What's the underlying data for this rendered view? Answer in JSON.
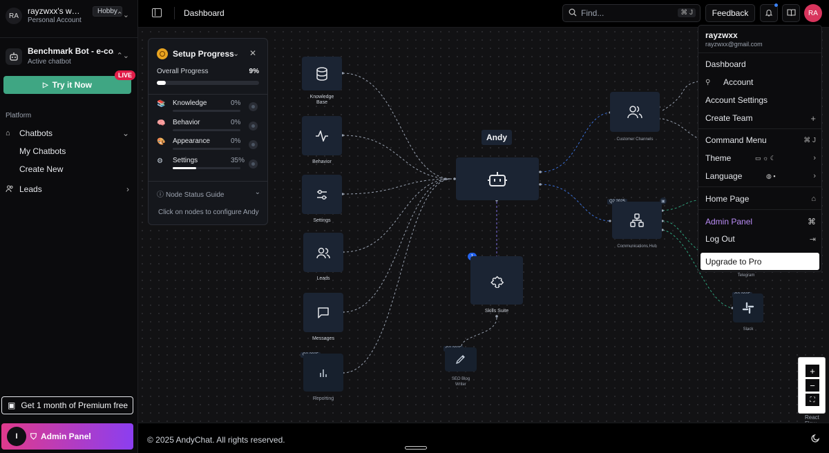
{
  "workspace": {
    "avatar": "RA",
    "name": "rayzwxx's wo...",
    "account": "Personal Account",
    "plan": "Hobby"
  },
  "bot": {
    "name": "Benchmark Bot - e-co...",
    "status": "Active chatbot"
  },
  "try_label": "Try it Now",
  "live_label": "LIVE",
  "platform_label": "Platform",
  "nav": {
    "chatbots": "Chatbots",
    "my_chatbots": "My Chatbots",
    "create_new": "Create New",
    "leads": "Leads"
  },
  "premium_label": "Get 1 month of Premium free",
  "admin": {
    "avatar": "I",
    "label": "Admin Panel"
  },
  "top": {
    "page": "Dashboard",
    "find_placeholder": "Find...",
    "find_kbd": "⌘ J",
    "feedback": "Feedback",
    "avatar": "RA"
  },
  "setup": {
    "title": "Setup Progress",
    "overall_label": "Overall Progress",
    "overall": 9,
    "overall_text": "9%",
    "items": [
      {
        "label": "Knowledge",
        "pct": 0,
        "text": "0%"
      },
      {
        "label": "Behavior",
        "pct": 0,
        "text": "0%"
      },
      {
        "label": "Appearance",
        "pct": 0,
        "text": "0%"
      },
      {
        "label": "Settings",
        "pct": 35,
        "text": "35%"
      }
    ],
    "guide": "Node Status Guide",
    "hint": "Click on nodes to configure Andy"
  },
  "nodes": {
    "knowledge": "Knowledge\nBase",
    "behavior": "Behavior",
    "settings": "Settings",
    "leads": "Leads",
    "messages": "Messages",
    "reporting": "Reporting",
    "bot_name": "Andy",
    "skills": "Skills Suite",
    "seo": "SEO Blog\nWriter",
    "customer": "Customer Channels",
    "comms": "Communications Hub",
    "telegram": "Telegram",
    "slack": "Slack",
    "q2": "Q2 2025",
    "skills_count": "1"
  },
  "menu": {
    "name": "rayzwxx",
    "email": "rayzwxx@gmail.com",
    "dashboard": "Dashboard",
    "account": "Account",
    "account_settings": "Account Settings",
    "create_team": "Create Team",
    "command_menu": "Command Menu",
    "command_kbd": "⌘ J",
    "theme": "Theme",
    "language": "Language",
    "home": "Home Page",
    "admin": "Admin Panel",
    "logout": "Log Out",
    "upgrade": "Upgrade to Pro"
  },
  "footer": "© 2025 AndyChat. All rights reserved.",
  "react_flow": "React Flow",
  "colors": {
    "accent": "#3fa683",
    "live": "#e11d48",
    "admin_grad_start": "#e03a8c",
    "admin_grad_end": "#8b3ef0",
    "admin_text": "#b98cf5",
    "node_bg": "#1b2433",
    "canvas": "#121214"
  }
}
